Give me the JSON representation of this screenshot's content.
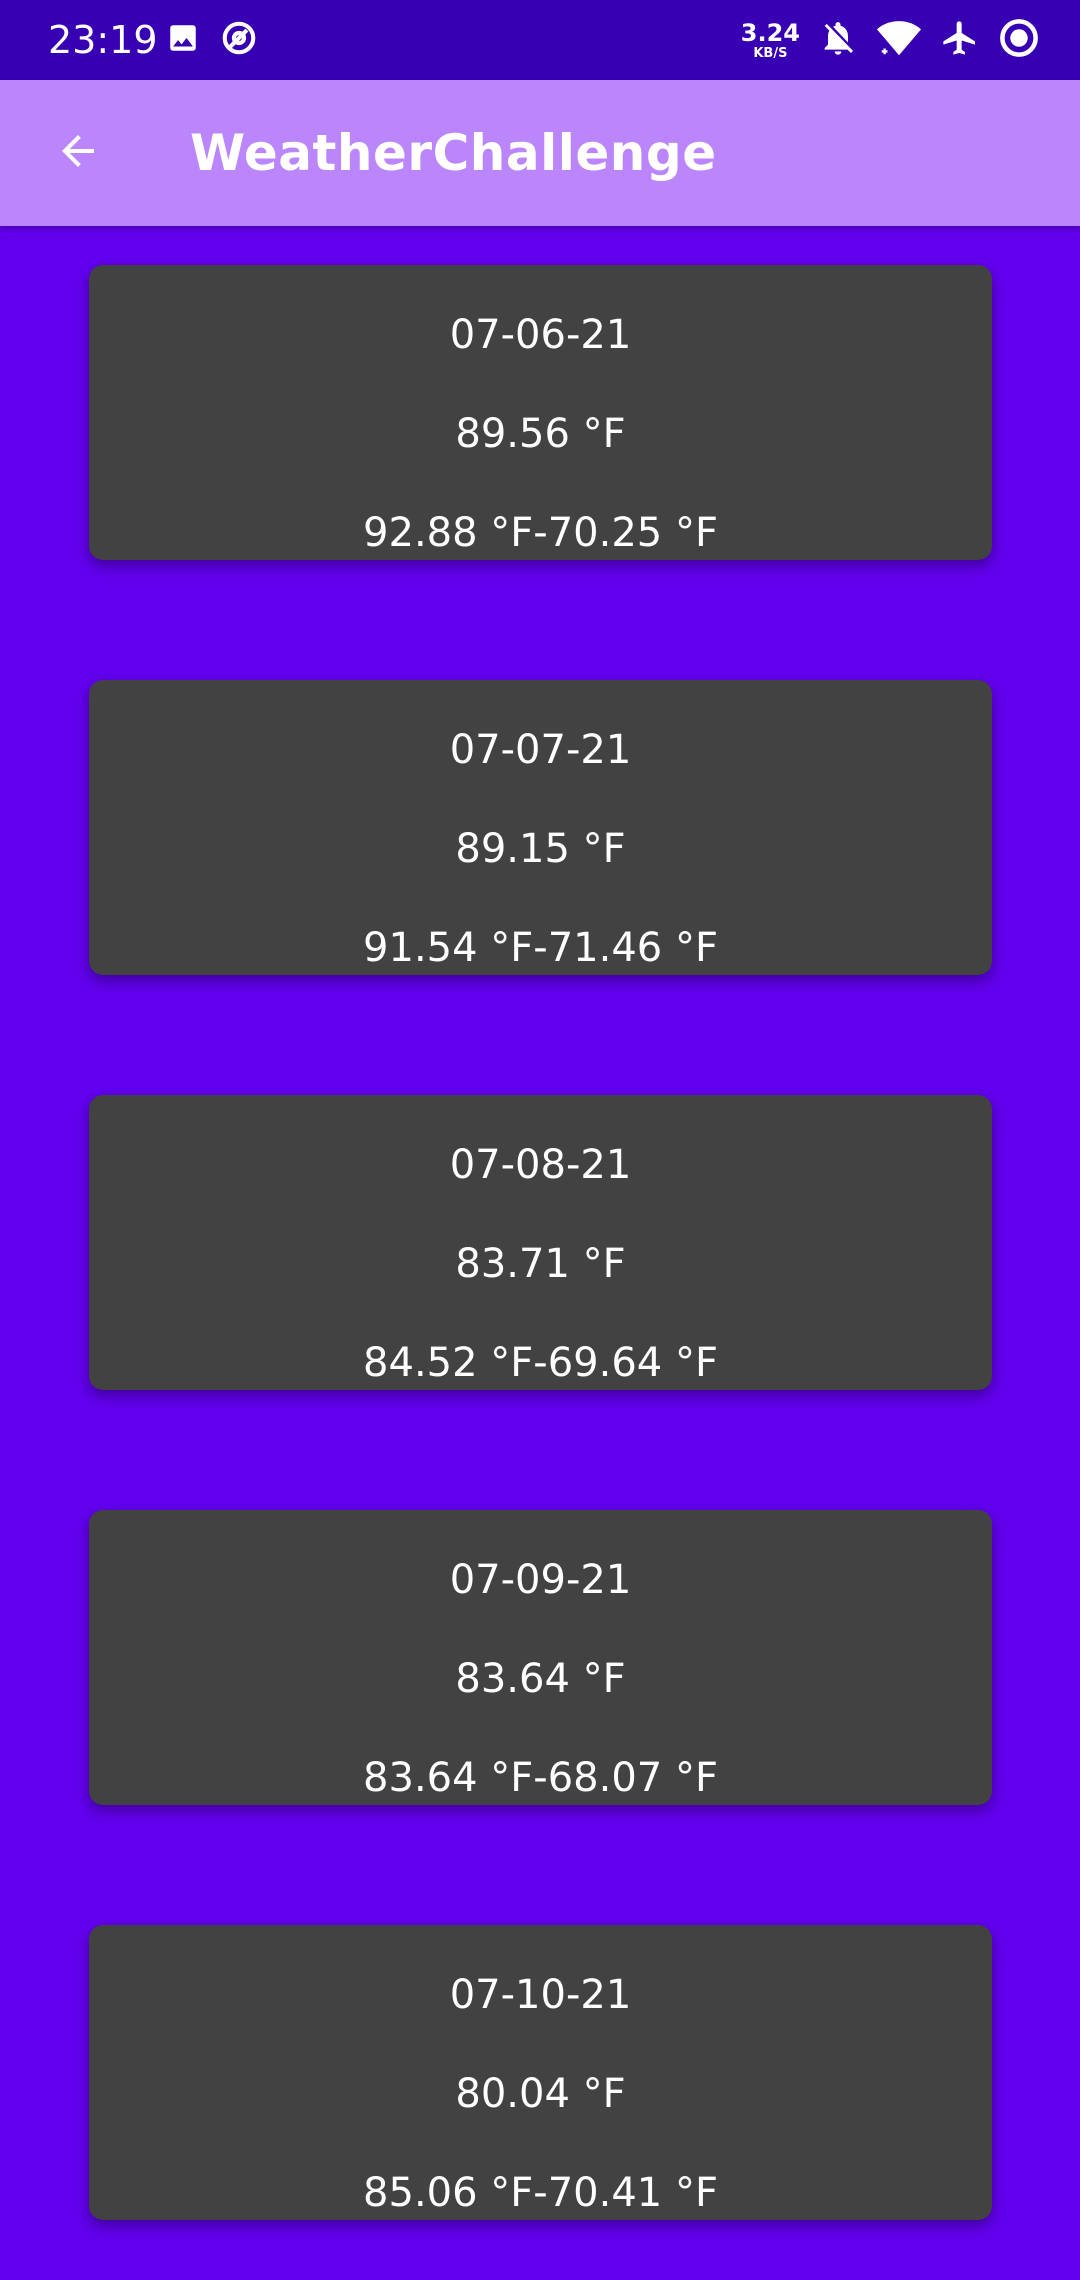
{
  "status_bar": {
    "time": "23:19",
    "left_icons": [
      "image-icon",
      "sync-icon"
    ],
    "net_speed_value": "3.24",
    "net_speed_unit": "KB/S",
    "right_icons": [
      "notifications-off-icon",
      "wifi-icon",
      "airplane-icon",
      "record-icon"
    ]
  },
  "app_bar": {
    "back_icon": "arrow-back-icon",
    "title": "WeatherChallenge"
  },
  "colors": {
    "status_bar": "#3700B3",
    "app_bar": "#BB86FC",
    "background": "#6200EE",
    "card": "#424242",
    "text": "#FFFFFF"
  },
  "forecast": [
    {
      "date": "07-06-21",
      "temp": "89.56 °F",
      "range": "92.88 °F-70.25 °F"
    },
    {
      "date": "07-07-21",
      "temp": "89.15 °F",
      "range": "91.54 °F-71.46 °F"
    },
    {
      "date": "07-08-21",
      "temp": "83.71 °F",
      "range": "84.52 °F-69.64 °F"
    },
    {
      "date": "07-09-21",
      "temp": "83.64 °F",
      "range": "83.64 °F-68.07 °F"
    },
    {
      "date": "07-10-21",
      "temp": "80.04 °F",
      "range": "85.06 °F-70.41 °F"
    }
  ]
}
